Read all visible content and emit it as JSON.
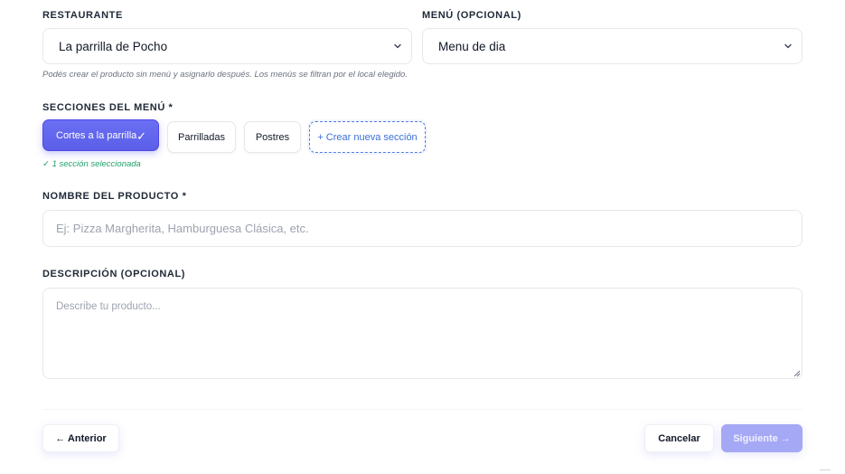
{
  "restaurant": {
    "label": "RESTAURANTE",
    "selected": "La parrilla de Pocho"
  },
  "menu": {
    "label": "MENÚ (OPCIONAL)",
    "selected": "Menu de dia"
  },
  "menu_hint": "Podés crear el producto sin menú y asignarlo después. Los menús se filtran por el local elegido.",
  "sections": {
    "label": "SECCIONES DEL MENÚ *",
    "chips": [
      {
        "label": "Cortes a la parrilla",
        "selected": true
      },
      {
        "label": "Parrilladas",
        "selected": false
      },
      {
        "label": "Postres",
        "selected": false
      }
    ],
    "new_label": "+ Crear nueva sección",
    "status": "✓ 1 sección seleccionada"
  },
  "product_name": {
    "label": "NOMBRE DEL PRODUCTO *",
    "placeholder": "Ej: Pizza Margherita, Hamburguesa Clásica, etc.",
    "value": ""
  },
  "description": {
    "label": "DESCRIPCIÓN (OPCIONAL)",
    "placeholder": "Describe tu producto...",
    "value": ""
  },
  "footer": {
    "prev_label": "← Anterior",
    "cancel_label": "Cancelar",
    "next_label": "Siguiente →"
  },
  "colors": {
    "accent": "#6366f1",
    "accent_disabled": "#a5a8f4",
    "success": "#22a06b",
    "link_dashed": "#3b6fd8"
  },
  "icons": [
    "chevron-down-icon",
    "check-icon",
    "resize-grip-icon"
  ]
}
